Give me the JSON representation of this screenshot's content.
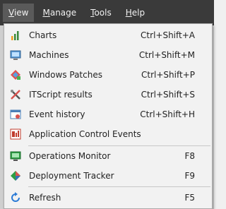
{
  "menubar": {
    "items": [
      {
        "label": "View",
        "accel": "V"
      },
      {
        "label": "Manage",
        "accel": "M"
      },
      {
        "label": "Tools",
        "accel": "T"
      },
      {
        "label": "Help",
        "accel": "H"
      }
    ]
  },
  "view_menu": {
    "items": [
      {
        "label": "Charts",
        "shortcut": "Ctrl+Shift+A",
        "icon": "charts-icon"
      },
      {
        "label": "Machines",
        "shortcut": "Ctrl+Shift+M",
        "icon": "machines-icon"
      },
      {
        "label": "Windows Patches",
        "shortcut": "Ctrl+Shift+P",
        "icon": "windows-patches-icon"
      },
      {
        "label": "ITScript results",
        "shortcut": "Ctrl+Shift+S",
        "icon": "itscript-icon"
      },
      {
        "label": "Event history",
        "shortcut": "Ctrl+Shift+H",
        "icon": "event-history-icon"
      },
      {
        "label": "Application Control Events",
        "shortcut": "",
        "icon": "application-control-icon"
      },
      {
        "label": "Operations Monitor",
        "shortcut": "F8",
        "icon": "operations-monitor-icon"
      },
      {
        "label": "Deployment Tracker",
        "shortcut": "F9",
        "icon": "deployment-tracker-icon"
      },
      {
        "label": "Refresh",
        "shortcut": "F5",
        "icon": "refresh-icon"
      }
    ]
  },
  "colors": {
    "menubar_bg": "#3a3a3a",
    "active_menu_bg": "#5a5a5a",
    "dropdown_bg": "#f2f2f2"
  }
}
